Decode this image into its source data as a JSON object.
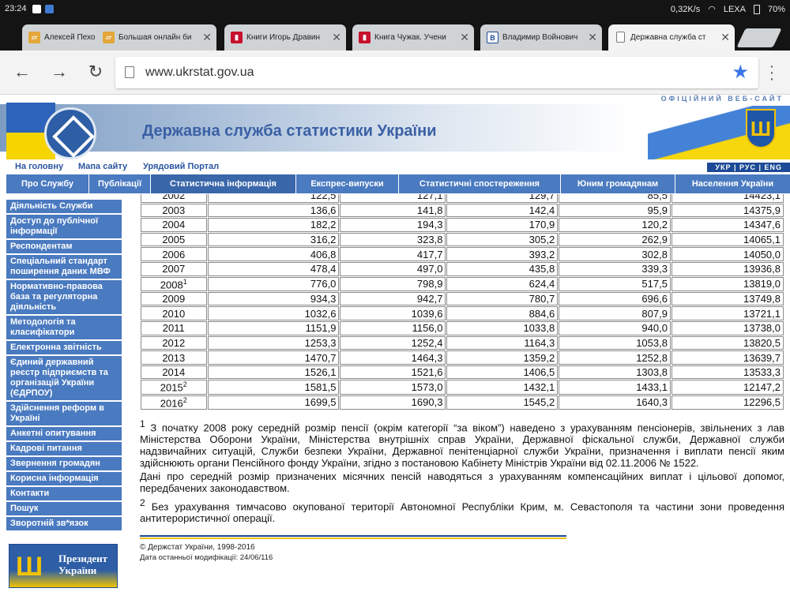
{
  "status_bar": {
    "time": "23:24",
    "net_speed": "0,32K/s",
    "carrier": "LEXA",
    "battery": "70%"
  },
  "tabs": [
    {
      "title": "Алексей Пехо",
      "icon": "book-icon"
    },
    {
      "title": "Большая онлайн би",
      "icon": "book-icon"
    },
    {
      "title": "Книги Игорь Дравин",
      "icon": "red-book-icon"
    },
    {
      "title": "Книга Чужак. Учени",
      "icon": "red-book-icon"
    },
    {
      "title": "Владимир Войнович",
      "icon": "v-icon"
    },
    {
      "title": "Державна служба ст",
      "icon": "page-icon"
    }
  ],
  "url": "www.ukrstat.gov.ua",
  "site": {
    "title": "Державна служба статистики України",
    "tagline": "ОФІЦІЙНИЙ ВЕБ-САЙТ",
    "trident": "Ш",
    "top_links": [
      "На головну",
      "Мапа сайту",
      "Урядовий Портал"
    ],
    "lang": "УКР | РУС | ENG",
    "nav": [
      "Про Службу",
      "Публікації",
      "Статистична інформація",
      "Експрес-випуски",
      "Статистичні спостереження",
      "Юним громадянам",
      "Населення України"
    ],
    "sidebar": [
      "Діяльність Служби",
      "Доступ до публічної інформації",
      "Респондентам",
      "Спеціальний стандарт поширення даних МВФ",
      "Нормативно-правова база та регуляторна діяльність",
      "Методологія та класифікатори",
      "Електронна звітність",
      "Єдиний державний реєстр підприємств та організацій України (ЄДРПОУ)",
      "Здійснення реформ в Україні",
      "Анкетні опитування",
      "Кадрові питання",
      "Звернення громадян",
      "Корисна інформація",
      "Контакти",
      "Пошук",
      "Зворотній зв*язок"
    ],
    "president_banner": "Президент України"
  },
  "table": {
    "rows": [
      {
        "year": "2002",
        "sup": "",
        "values": [
          "122,5",
          "127,1",
          "129,7",
          "85,5",
          "14423,1"
        ]
      },
      {
        "year": "2003",
        "sup": "",
        "values": [
          "136,6",
          "141,8",
          "142,4",
          "95,9",
          "14375,9"
        ]
      },
      {
        "year": "2004",
        "sup": "",
        "values": [
          "182,2",
          "194,3",
          "170,9",
          "120,2",
          "14347,6"
        ]
      },
      {
        "year": "2005",
        "sup": "",
        "values": [
          "316,2",
          "323,8",
          "305,2",
          "262,9",
          "14065,1"
        ]
      },
      {
        "year": "2006",
        "sup": "",
        "values": [
          "406,8",
          "417,7",
          "393,2",
          "302,8",
          "14050,0"
        ]
      },
      {
        "year": "2007",
        "sup": "",
        "values": [
          "478,4",
          "497,0",
          "435,8",
          "339,3",
          "13936,8"
        ]
      },
      {
        "year": "2008",
        "sup": "1",
        "values": [
          "776,0",
          "798,9",
          "624,4",
          "517,5",
          "13819,0"
        ]
      },
      {
        "year": "2009",
        "sup": "",
        "values": [
          "934,3",
          "942,7",
          "780,7",
          "696,6",
          "13749,8"
        ]
      },
      {
        "year": "2010",
        "sup": "",
        "values": [
          "1032,6",
          "1039,6",
          "884,6",
          "807,9",
          "13721,1"
        ]
      },
      {
        "year": "2011",
        "sup": "",
        "values": [
          "1151,9",
          "1156,0",
          "1033,8",
          "940,0",
          "13738,0"
        ]
      },
      {
        "year": "2012",
        "sup": "",
        "values": [
          "1253,3",
          "1252,4",
          "1164,3",
          "1053,8",
          "13820,5"
        ]
      },
      {
        "year": "2013",
        "sup": "",
        "values": [
          "1470,7",
          "1464,3",
          "1359,2",
          "1252,8",
          "13639,7"
        ]
      },
      {
        "year": "2014",
        "sup": "",
        "values": [
          "1526,1",
          "1521,6",
          "1406,5",
          "1303,8",
          "13533,3"
        ]
      },
      {
        "year": "2015",
        "sup": "2",
        "values": [
          "1581,5",
          "1573,0",
          "1432,1",
          "1433,1",
          "12147,2"
        ]
      },
      {
        "year": "2016",
        "sup": "2",
        "values": [
          "1699,5",
          "1690,3",
          "1545,2",
          "1640,3",
          "12296,5"
        ]
      }
    ]
  },
  "notes": {
    "n1_mark": "1",
    "n1_text": "З початку 2008 року середній розмір пенсії (окрім категорії “за віком”) наведено з урахуванням пенсіонерів, звільнених з лав Міністерства Оборони України, Міністерства внутрішніх справ України, Державної фіскальної служби, Державної служби надзвичайних ситуацій, Служби безпеки України, Державної пенітенціарної служби України, призначення і виплати пенсії яким здійснюють органи Пенсійного фонду України, згідно з постановою Кабінету Міністрів України від 02.11.2006 № 1522.",
    "n1_extra": "Дані про середній розмір призначених місячних пенсій наводяться з урахуванням компенсаційних виплат і цільової допомог, передбачених законодавством.",
    "n2_mark": "2",
    "n2_text": "Без урахування тимчасово окупованої території Автономної Республіки Крим, м. Севастополя та частини зони проведення антитерористичної операції."
  },
  "footer": {
    "copyright": "© Держстат України, 1998-2016",
    "modified_label": "Дата останньої модифікації:",
    "modified_date": "24/06/116"
  }
}
